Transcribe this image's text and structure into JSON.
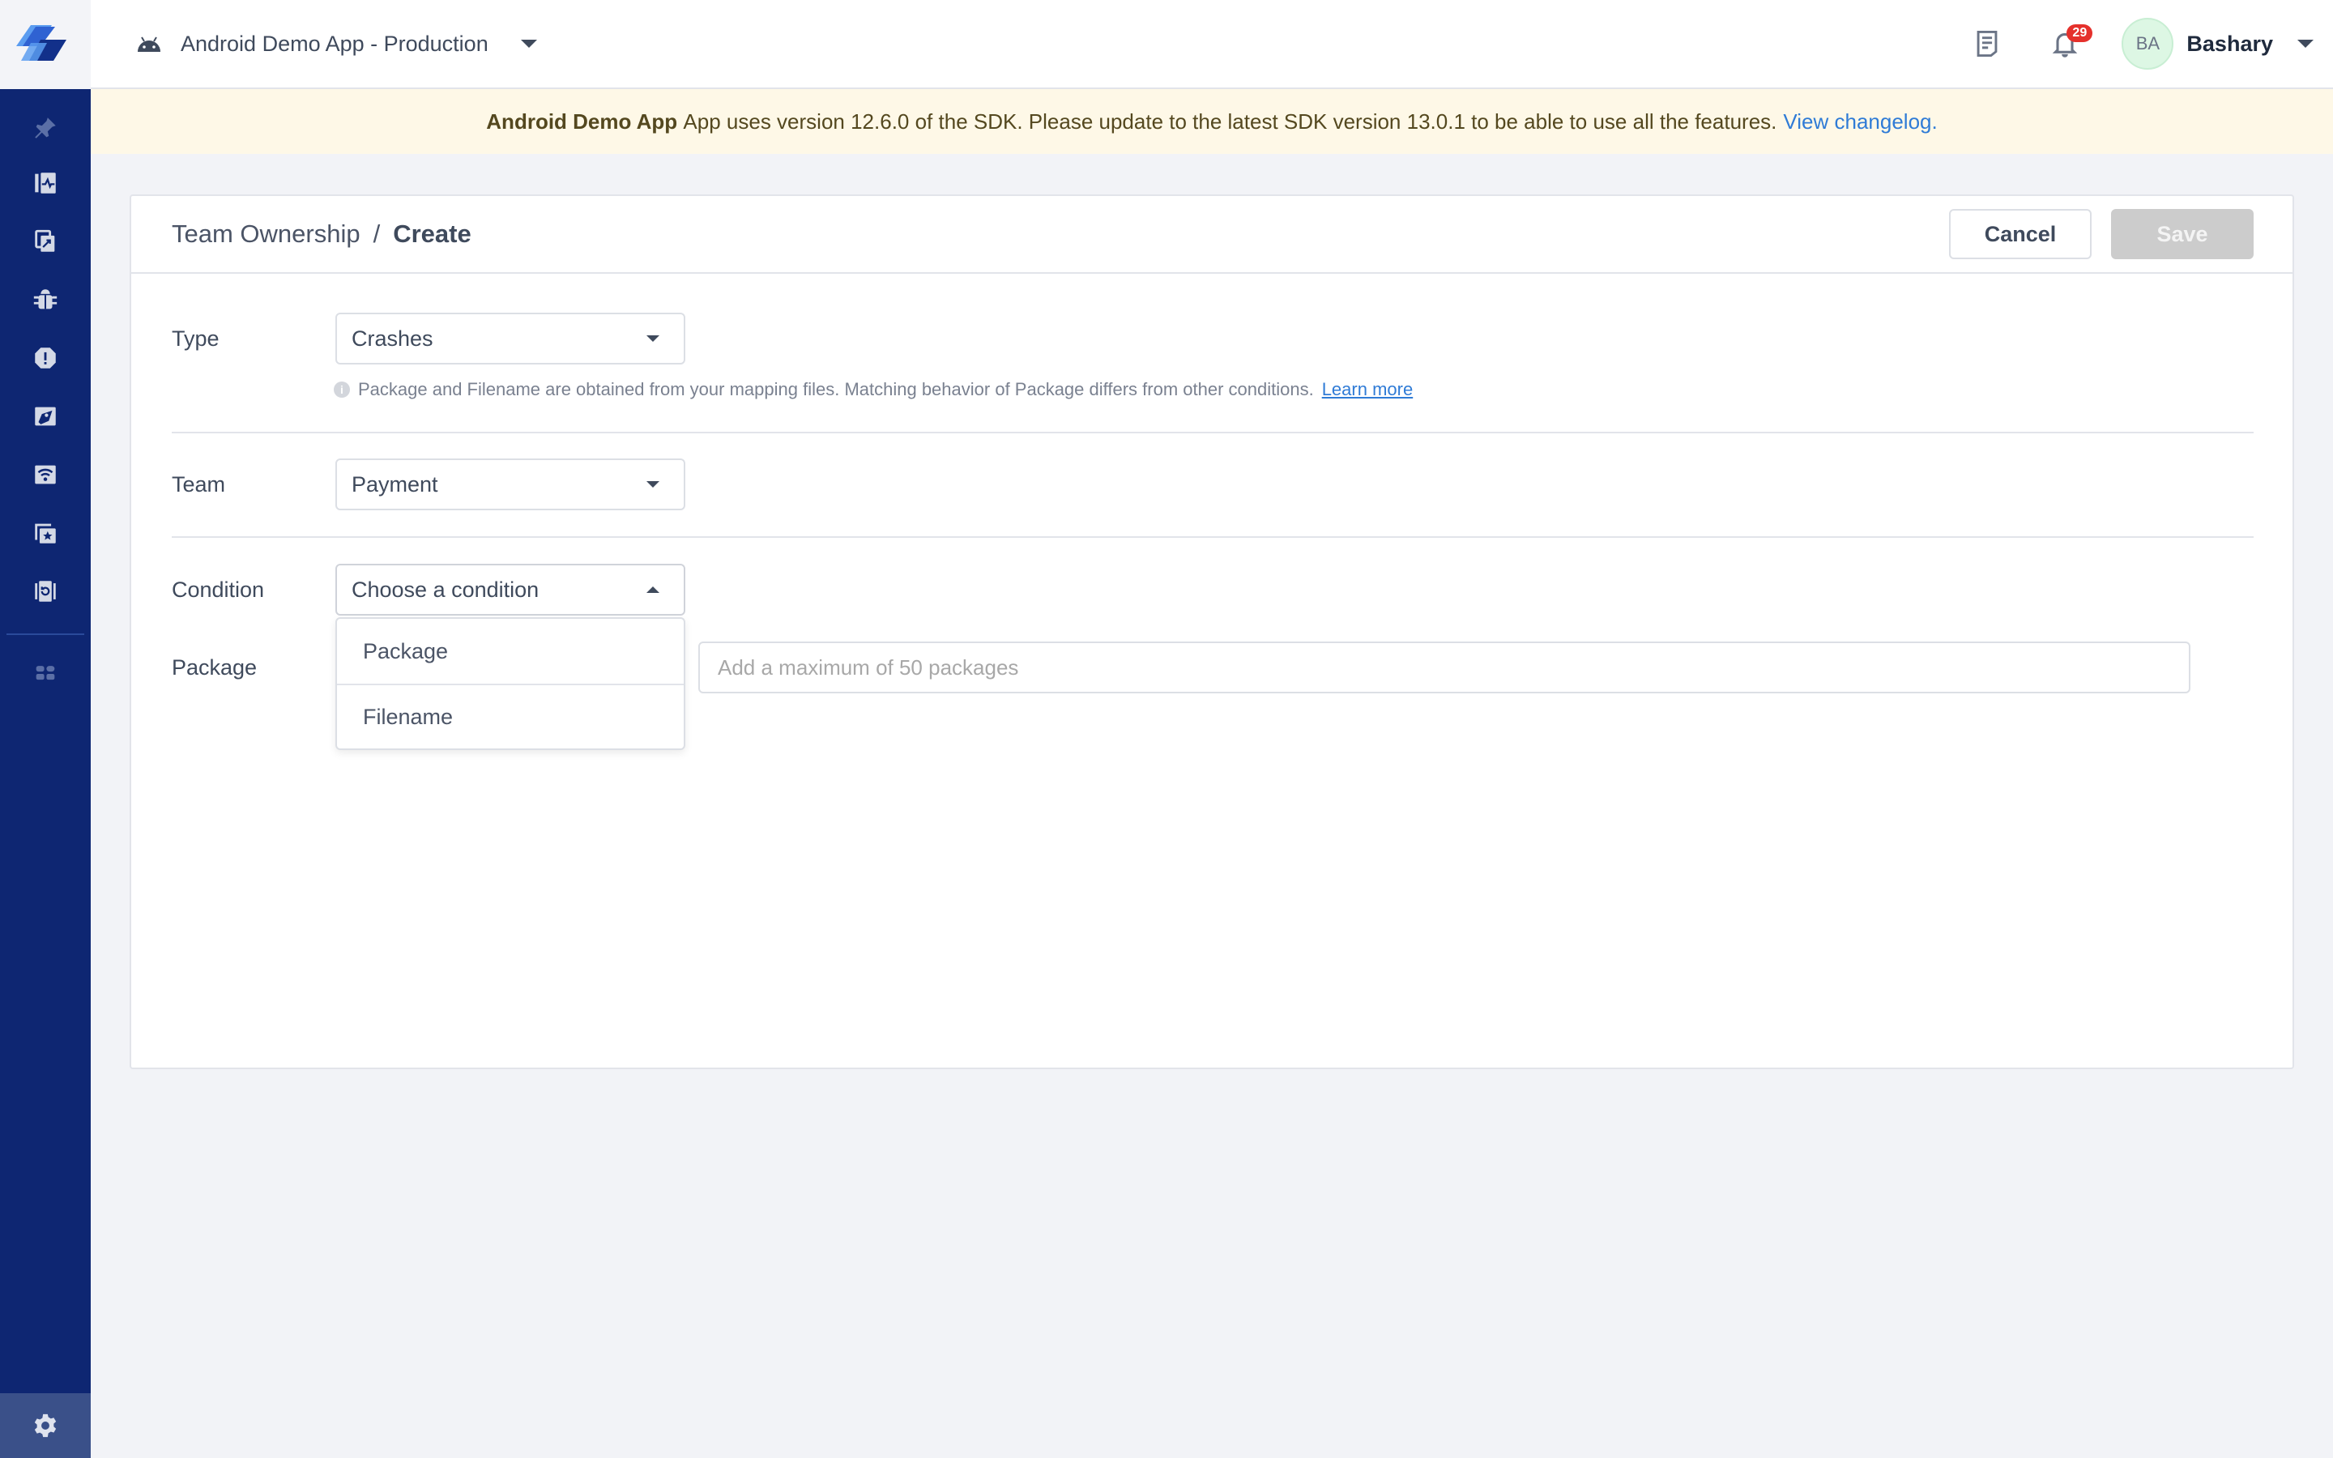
{
  "topbar": {
    "app_name": "Android Demo App - Production",
    "notification_count": "29",
    "user_initials": "BA",
    "user_name": "Bashary"
  },
  "banner": {
    "app_bold": "Android Demo App",
    "message": "App uses version 12.6.0 of the SDK. Please update to the latest SDK version 13.0.1 to be able to use all the features.",
    "link": "View changelog."
  },
  "sidebar": {
    "items": [
      "pin-icon",
      "performance-icon",
      "app-ratings-icon",
      "bugs-icon",
      "crashes-icon",
      "releases-icon",
      "network-icon",
      "surveys-icon",
      "session-replay-icon"
    ],
    "more": "apps-grid-icon",
    "settings": "gear-icon"
  },
  "page": {
    "breadcrumb_root": "Team Ownership",
    "breadcrumb_sep": "/",
    "breadcrumb_current": "Create",
    "cancel_label": "Cancel",
    "save_label": "Save"
  },
  "form": {
    "type_label": "Type",
    "type_value": "Crashes",
    "hint_text": "Package and Filename are obtained from your mapping files. Matching behavior of Package differs from other conditions.",
    "hint_link": "Learn more",
    "team_label": "Team",
    "team_value": "Payment",
    "condition_label": "Condition",
    "condition_value": "Choose a condition",
    "condition_options": [
      "Package",
      "Filename"
    ],
    "package_label": "Package",
    "package_placeholder": "Add a maximum of 50 packages",
    "package_value": ""
  }
}
